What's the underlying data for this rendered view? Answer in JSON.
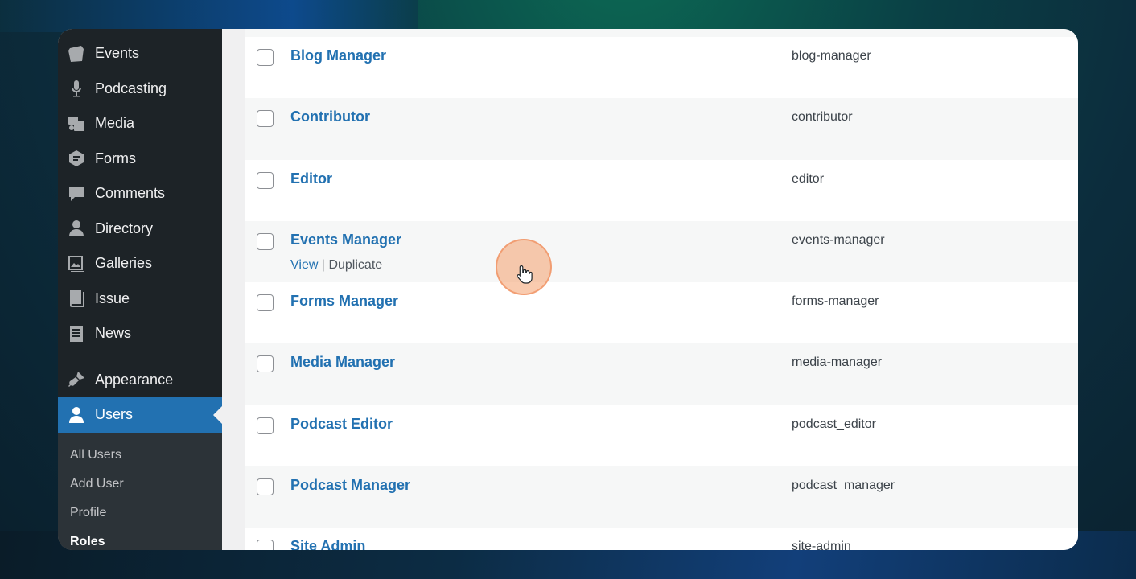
{
  "sidebar": {
    "items": [
      {
        "label": "Events",
        "icon": "calendar-icon"
      },
      {
        "label": "Podcasting",
        "icon": "microphone-icon"
      },
      {
        "label": "Media",
        "icon": "media-icon"
      },
      {
        "label": "Forms",
        "icon": "forms-icon"
      },
      {
        "label": "Comments",
        "icon": "comment-icon"
      },
      {
        "label": "Directory",
        "icon": "person-icon"
      },
      {
        "label": "Galleries",
        "icon": "gallery-icon"
      },
      {
        "label": "Issue",
        "icon": "book-icon"
      },
      {
        "label": "News",
        "icon": "document-icon"
      },
      {
        "label": "Appearance",
        "icon": "paintbrush-icon"
      },
      {
        "label": "Users",
        "icon": "users-icon"
      }
    ],
    "submenu": [
      "All Users",
      "Add User",
      "Profile",
      "Roles"
    ]
  },
  "roles": [
    {
      "name": "Blog Manager",
      "slug": "blog-manager"
    },
    {
      "name": "Contributor",
      "slug": "contributor"
    },
    {
      "name": "Editor",
      "slug": "editor"
    },
    {
      "name": "Events Manager",
      "slug": "events-manager",
      "actions": {
        "view": "View",
        "separator": "|",
        "duplicate": "Duplicate"
      }
    },
    {
      "name": "Forms Manager",
      "slug": "forms-manager"
    },
    {
      "name": "Media Manager",
      "slug": "media-manager"
    },
    {
      "name": "Podcast Editor",
      "slug": "podcast_editor"
    },
    {
      "name": "Podcast Manager",
      "slug": "podcast_manager"
    },
    {
      "name": "Site Admin",
      "slug": "site-admin"
    }
  ],
  "colors": {
    "accent": "#2271b1",
    "sidebar_bg": "#1d2327",
    "submenu_bg": "#2c3338"
  }
}
